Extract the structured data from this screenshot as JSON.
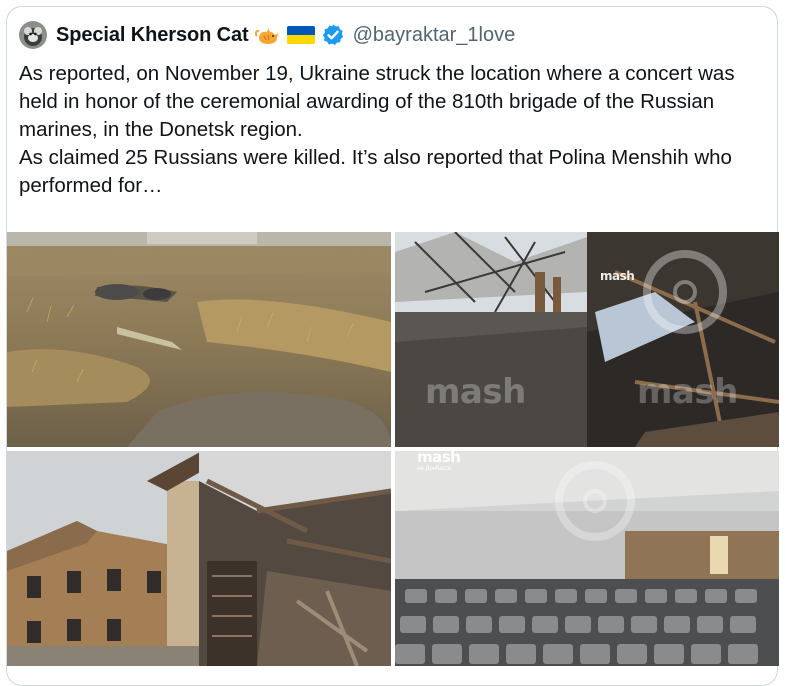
{
  "tweet": {
    "author": {
      "display_name": "Special Kherson Cat",
      "handle": "@bayraktar_1love",
      "verified": true,
      "name_emoji": [
        "cat-emoji",
        "ukraine-flag-emoji"
      ]
    },
    "text_paragraphs": [
      "As reported, on November 19, Ukraine struck the location where a concert was held in honor of the ceremonial awarding of the 810th brigade of the Russian marines, in the Donetsk region.",
      "As claimed 25 Russians were killed. It’s also reported that Polina Menshih who performed for…"
    ]
  },
  "media": {
    "watermark_brand": "mash",
    "watermark_sub": "на Донбассе",
    "images": [
      {
        "name": "field-photo",
        "description_icon": "photo"
      },
      {
        "name": "destroyed-hall-photo",
        "description_icon": "photo"
      },
      {
        "name": "damaged-building-photo",
        "description_icon": "photo"
      },
      {
        "name": "auditorium-photo",
        "description_icon": "photo"
      }
    ]
  },
  "colors": {
    "text": "#0f1419",
    "secondary_text": "#536471",
    "border": "#cfd9de",
    "verified_blue": "#1d9bf0",
    "flag_blue": "#0057b7",
    "flag_yellow": "#ffd700"
  }
}
